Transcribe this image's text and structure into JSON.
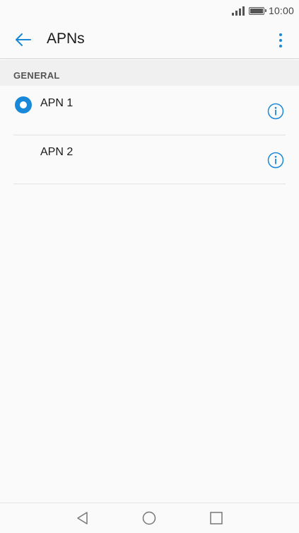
{
  "status_bar": {
    "time": "10:00",
    "signal_icon": "cell-signal-icon",
    "battery_icon": "battery-full-icon"
  },
  "app_bar": {
    "title": "APNs",
    "back_icon": "arrow-back-icon",
    "menu_icon": "more-vert-icon"
  },
  "section": {
    "label": "GENERAL"
  },
  "apns": [
    {
      "name": "APN 1",
      "selected": true
    },
    {
      "name": "APN 2",
      "selected": false
    }
  ],
  "nav_bar": {
    "back_icon": "nav-back-icon",
    "home_icon": "nav-home-icon",
    "recents_icon": "nav-recents-icon"
  },
  "colors": {
    "accent": "#1a88d8",
    "background": "#fafafa",
    "section_background": "#f0f0f0"
  }
}
